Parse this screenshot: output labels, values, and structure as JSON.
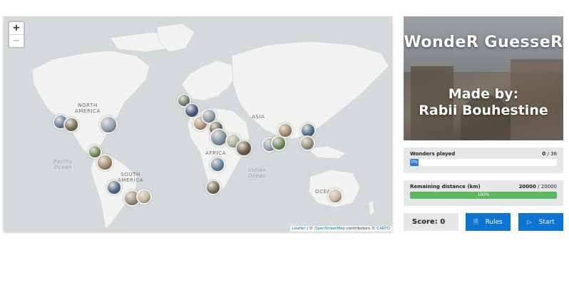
{
  "map": {
    "zoom_in": "+",
    "zoom_out": "−",
    "labels": {
      "north_america": "NORTH\nAMERICA",
      "south_america": "SOUTH\nAMERICA",
      "africa": "AFRICA",
      "asia": "ASIA",
      "oceania": "OCEANIA",
      "pacific": "Pacific\nOcean",
      "indian": "Indian\nOcean"
    },
    "attribution": {
      "leaflet": "Leaflet",
      "sep1": " | © ",
      "osm": "OpenStreetMap",
      "mid": " contributors © ",
      "carto": "CARTO"
    },
    "marker_colors": [
      "#5f7f9e",
      "#7d6a52",
      "#8fa0b3",
      "#6c8a5a",
      "#a08a6a",
      "#4a6a8f",
      "#9b8e7a",
      "#c7b59a",
      "#6f7f6a",
      "#3f5a7a",
      "#b59a7a",
      "#8a9aa8",
      "#5a6a4f",
      "#7a8f9f",
      "#a8b5a0",
      "#6a5a4a"
    ]
  },
  "hero": {
    "title": "WondeR GuesseR",
    "made_by": "Made by:",
    "author": "Rabii Bouhestine"
  },
  "wonders": {
    "label": "Wonders played",
    "current": "0",
    "total": " / 38",
    "progress": 0,
    "progress_text": "0%"
  },
  "distance": {
    "label": "Remaining distance (km)",
    "current": "20000",
    "total": " / 20000",
    "progress": 100,
    "progress_text": "100%"
  },
  "score_text": "Score: 0",
  "buttons": {
    "rules_icon": "🗎",
    "rules": "Rules",
    "start_icon": "▷",
    "start": "Start"
  },
  "colors": {
    "accent": "#0d74d1",
    "progress_blue": "#2f7fd0",
    "progress_green": "#5cb85c",
    "panel_bg": "#e5e7e9",
    "ocean": "#d4dadc",
    "land": "#f2f2f0"
  }
}
